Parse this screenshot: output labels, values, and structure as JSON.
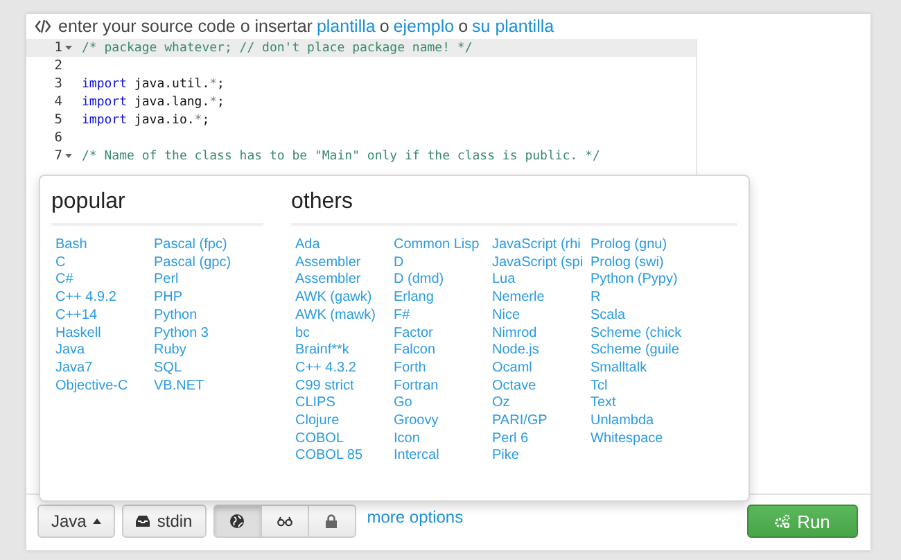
{
  "header": {
    "parts": [
      {
        "kind": "text",
        "text": "enter your source code o insertar"
      },
      {
        "kind": "link",
        "text": "plantilla"
      },
      {
        "kind": "text",
        "text": "o"
      },
      {
        "kind": "link",
        "text": "ejemplo"
      },
      {
        "kind": "text",
        "text": "o"
      },
      {
        "kind": "link",
        "text": "su plantilla"
      }
    ]
  },
  "editor": {
    "lines": [
      {
        "number": "1",
        "foldable": true,
        "active": true,
        "tokens": [
          {
            "kind": "comment",
            "text": "/* package whatever; // don't place package name! */"
          }
        ]
      },
      {
        "number": "2",
        "foldable": false,
        "active": false
      },
      {
        "number": "3",
        "foldable": false,
        "active": false,
        "tokens": [
          {
            "kind": "keyword",
            "text": "import"
          },
          {
            "kind": "plain",
            "text": " java.util."
          },
          {
            "kind": "operator",
            "text": "*"
          },
          {
            "kind": "plain",
            "text": ";"
          }
        ]
      },
      {
        "number": "4",
        "foldable": false,
        "active": false,
        "tokens": [
          {
            "kind": "keyword",
            "text": "import"
          },
          {
            "kind": "plain",
            "text": " java.lang."
          },
          {
            "kind": "operator",
            "text": "*"
          },
          {
            "kind": "plain",
            "text": ";"
          }
        ]
      },
      {
        "number": "5",
        "foldable": false,
        "active": false,
        "tokens": [
          {
            "kind": "keyword",
            "text": "import"
          },
          {
            "kind": "plain",
            "text": " java.io."
          },
          {
            "kind": "operator",
            "text": "*"
          },
          {
            "kind": "plain",
            "text": ";"
          }
        ]
      },
      {
        "number": "6",
        "foldable": false,
        "active": false
      },
      {
        "number": "7",
        "foldable": true,
        "active": false,
        "tokens": [
          {
            "kind": "comment",
            "text": "/* Name of the class has to be \"Main\" only if the class is public. */"
          }
        ]
      }
    ]
  },
  "language_menu": {
    "sections": [
      {
        "title": "popular",
        "columns": [
          [
            "Bash",
            "C",
            "C#",
            "C++ 4.9.2",
            "C++14",
            "Haskell",
            "Java",
            "Java7",
            "Objective-C"
          ],
          [
            "Pascal (fpc)",
            "Pascal (gpc)",
            "Perl",
            "PHP",
            "Python",
            "Python 3",
            "Ruby",
            "SQL",
            "VB.NET"
          ]
        ]
      },
      {
        "title": "others",
        "columns": [
          [
            "Ada",
            "Assembler",
            "Assembler",
            "AWK (gawk)",
            "AWK (mawk)",
            "bc",
            "Brainf**k",
            "C++ 4.3.2",
            "C99 strict",
            "CLIPS",
            "Clojure",
            "COBOL",
            "COBOL 85"
          ],
          [
            "Common Lisp",
            "D",
            "D (dmd)",
            "Erlang",
            "F#",
            "Factor",
            "Falcon",
            "Forth",
            "Fortran",
            "Go",
            "Groovy",
            "Icon",
            "Intercal"
          ],
          [
            "JavaScript (rhi",
            "JavaScript (spi",
            "Lua",
            "Nemerle",
            "Nice",
            "Nimrod",
            "Node.js",
            "Ocaml",
            "Octave",
            "Oz",
            "PARI/GP",
            "Perl 6",
            "Pike"
          ],
          [
            "Prolog (gnu)",
            "Prolog (swi)",
            "Python (Pypy)",
            "R",
            "Scala",
            "Scheme (chick",
            "Scheme (guile",
            "Smalltalk",
            "Tcl",
            "Text",
            "Unlambda",
            "Whitespace"
          ]
        ]
      }
    ]
  },
  "toolbar": {
    "language": "Java",
    "stdin": "stdin",
    "visibility": [
      {
        "kind": "public",
        "selected": true
      },
      {
        "kind": "hidden",
        "selected": false
      },
      {
        "kind": "private",
        "selected": false
      }
    ],
    "more_options": "more options",
    "run": "Run"
  }
}
